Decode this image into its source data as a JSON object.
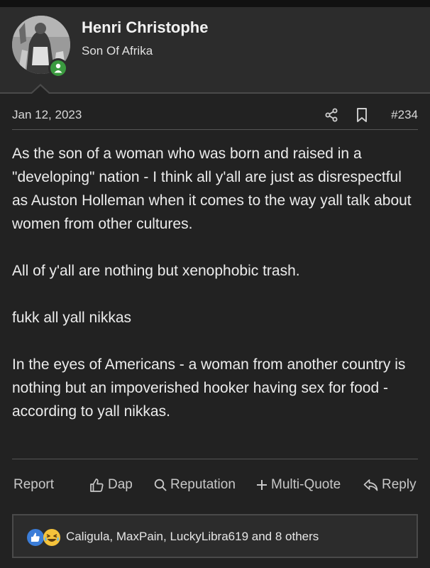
{
  "user": {
    "name": "Henri Christophe",
    "title": "Son Of Afrika",
    "online": true
  },
  "post": {
    "date": "Jan 12, 2023",
    "number": "#234",
    "paragraphs": [
      "As the son of a woman who was born and raised in a \"developing\" nation - I think all y'all are just as disrespectful as Auston Holleman when it comes to the way yall talk about women from other cultures.",
      "All of y'all are nothing but xenophobic trash.",
      "fukk all yall nikkas",
      "In the eyes of Americans - a woman from another country is nothing but an impoverished hooker having sex for food - according to yall nikkas."
    ]
  },
  "actions": {
    "report": "Report",
    "dap": "Dap",
    "reputation": "Reputation",
    "multiquote": "Multi-Quote",
    "reply": "Reply"
  },
  "reactions": {
    "icons": [
      "thumbs-up-icon",
      "laughing-emoji-icon"
    ],
    "text": "Caligula, MaxPain, LuckyLibra619 and 8 others"
  },
  "colors": {
    "background": "#222222",
    "header_background": "#2c2c2c",
    "online_green": "#3a9a3f",
    "like_blue": "#3b7dd8",
    "laugh_yellow": "#f5c33b"
  }
}
